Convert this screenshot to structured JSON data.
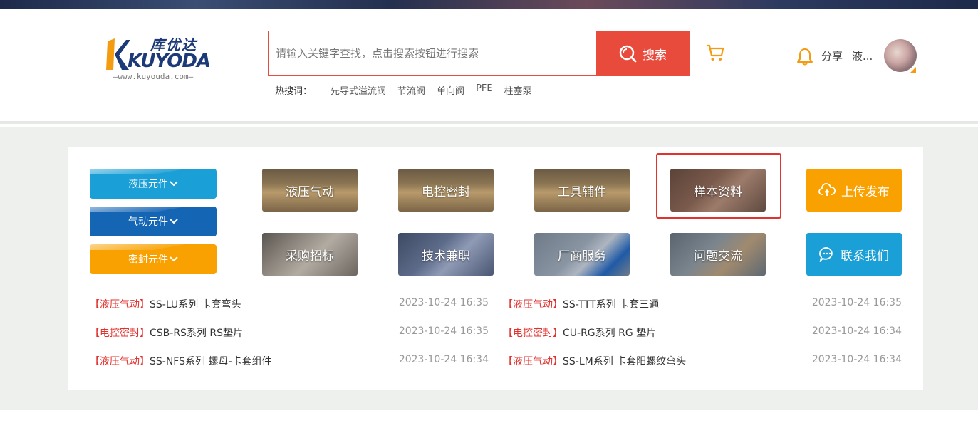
{
  "colors": {
    "accent": "#e84a3c",
    "orange": "#f39c12",
    "blue_cyan": "#1a9fd6",
    "blue_dark": "#1565b5",
    "tag_red": "#e0322e"
  },
  "logo": {
    "cn": "库优达",
    "en": "KUYODA",
    "url": "—www.kuyouda.com—"
  },
  "search": {
    "placeholder": "请输入关键字查找，点击搜索按钮进行搜索",
    "button_label": "搜索",
    "hot_label": "热搜词：",
    "hot_words": [
      "先导式溢流阀",
      "节流阀",
      "单向阀",
      "PFE",
      "柱塞泵"
    ]
  },
  "user": {
    "share_label": "分享",
    "name": "液..."
  },
  "categories": [
    {
      "label": "液压元件",
      "color": "#1a9fd6"
    },
    {
      "label": "气动元件",
      "color": "#1565b5"
    },
    {
      "label": "密封元件",
      "color": "#f8a100"
    }
  ],
  "tiles": [
    {
      "label": "液压气动",
      "style": "boxes"
    },
    {
      "label": "电控密封",
      "style": "boxes"
    },
    {
      "label": "工具辅件",
      "style": "boxes"
    },
    {
      "label": "样本资料",
      "style": "wood"
    },
    {
      "label": "采购招标",
      "style": "parts"
    },
    {
      "label": "技术兼职",
      "style": "keyboard"
    },
    {
      "label": "厂商服务",
      "style": "service"
    },
    {
      "label": "问题交流",
      "style": "meeting"
    }
  ],
  "actions": [
    {
      "label": "上传发布",
      "icon": "cloud-upload-icon",
      "color": "#f8a100"
    },
    {
      "label": "联系我们",
      "icon": "chat-bubble-icon",
      "color": "#1a9fd6"
    }
  ],
  "news": [
    {
      "tag": "【液压气动】",
      "title": "SS-LU系列 卡套弯头",
      "time": "2023-10-24 16:35"
    },
    {
      "tag": "【液压气动】",
      "title": "SS-TTT系列 卡套三通",
      "time": "2023-10-24 16:35"
    },
    {
      "tag": "【电控密封】",
      "title": "CSB-RS系列 RS垫片",
      "time": "2023-10-24 16:35"
    },
    {
      "tag": "【电控密封】",
      "title": "CU-RG系列 RG 垫片",
      "time": "2023-10-24 16:34"
    },
    {
      "tag": "【液压气动】",
      "title": "SS-NFS系列 螺母-卡套组件",
      "time": "2023-10-24 16:34"
    },
    {
      "tag": "【液压气动】",
      "title": "SS-LM系列 卡套阳螺纹弯头",
      "time": "2023-10-24 16:34"
    }
  ]
}
